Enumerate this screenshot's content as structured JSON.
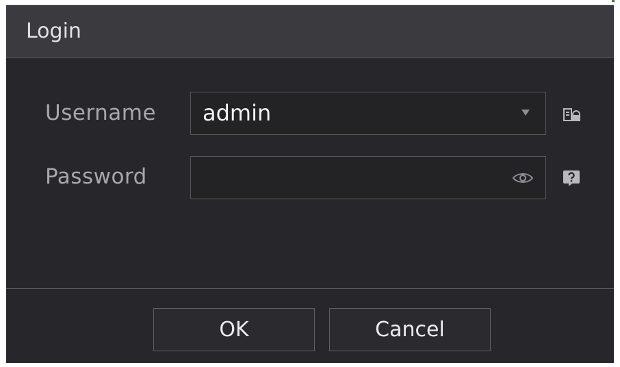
{
  "dialog": {
    "title": "Login"
  },
  "form": {
    "username": {
      "label": "Username",
      "value": "admin"
    },
    "password": {
      "label": "Password",
      "value": ""
    }
  },
  "buttons": {
    "ok_label": "OK",
    "cancel_label": "Cancel"
  },
  "icons": {
    "dropdown": "chevron-down-icon",
    "show_password": "eye-icon",
    "user_manager": "user-manager-icon",
    "password_help": "question-icon"
  },
  "colors": {
    "background": "#27272b",
    "titlebar": "#3a3a3f",
    "text": "#f2f2f4",
    "label": "#a7a7ac",
    "border": "#58585d"
  }
}
